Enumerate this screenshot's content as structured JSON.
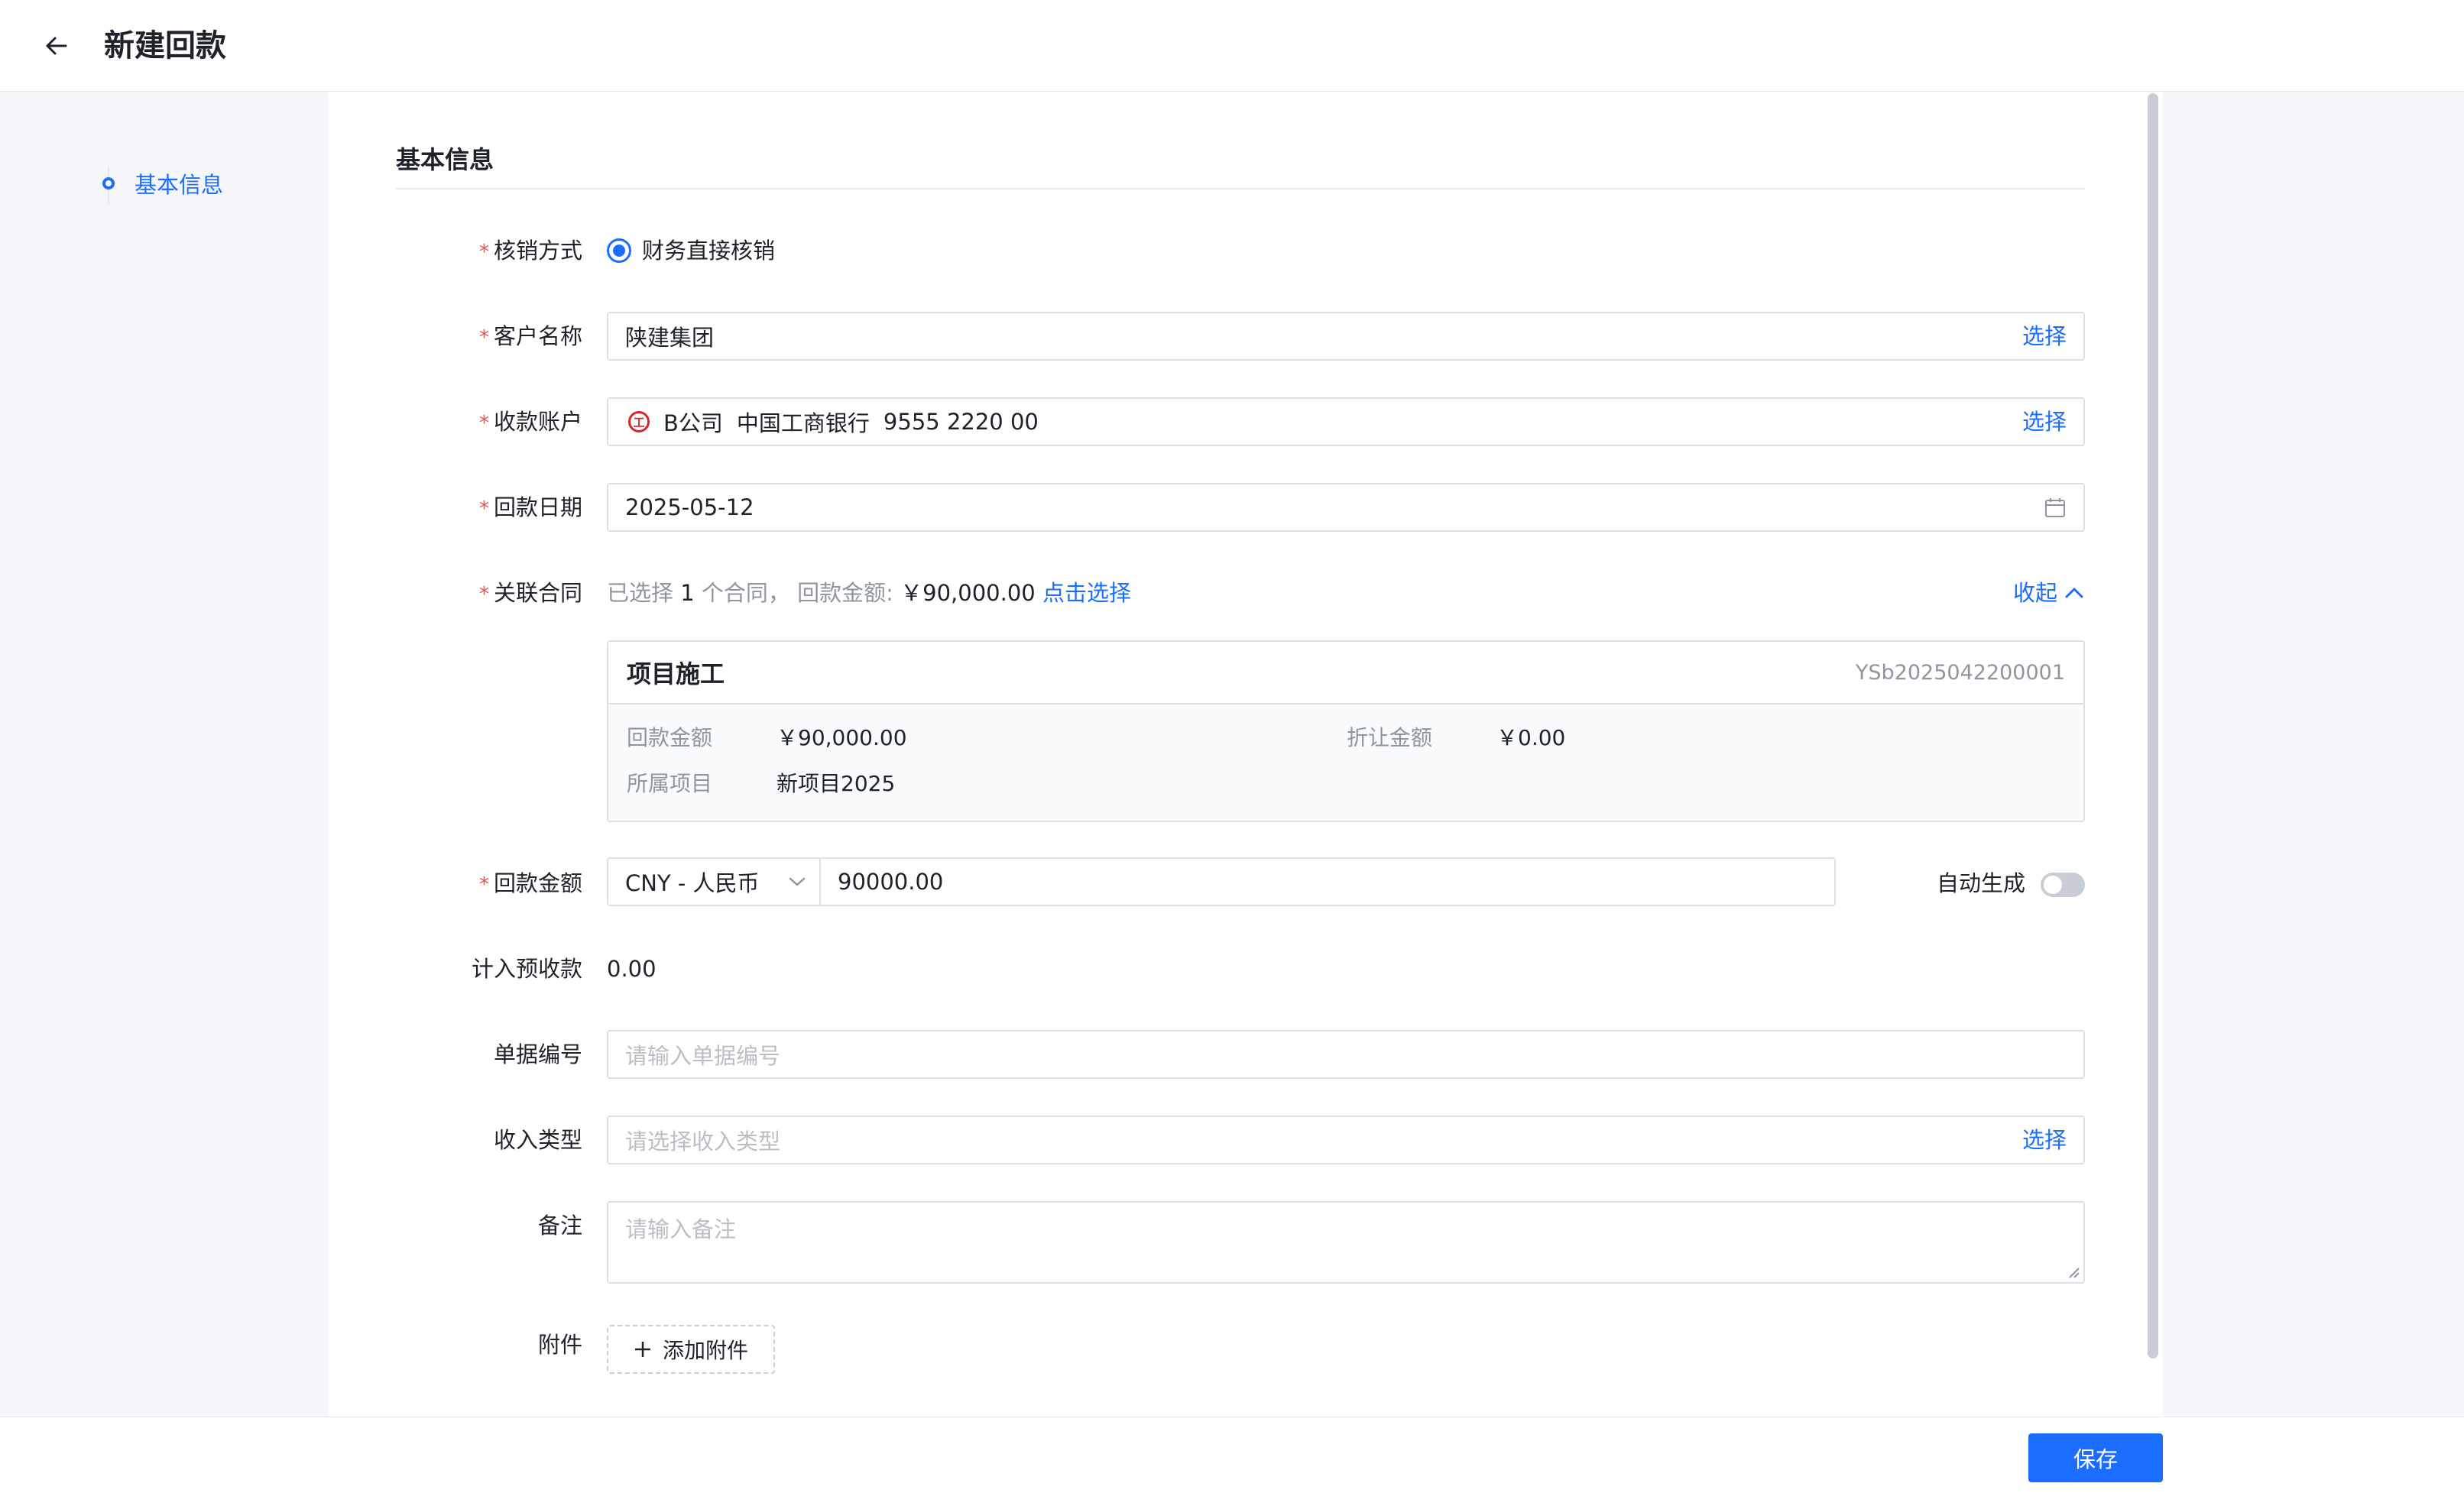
{
  "header": {
    "title": "新建回款"
  },
  "nav": {
    "items": [
      {
        "label": "基本信息"
      }
    ]
  },
  "section": {
    "title": "基本信息"
  },
  "form": {
    "writeoff": {
      "label": "核销方式",
      "option": "财务直接核销"
    },
    "customer": {
      "label": "客户名称",
      "value": "陕建集团",
      "action": "选择"
    },
    "account": {
      "label": "收款账户",
      "bank_icon_text": "工",
      "company": "B公司",
      "bank": "中国工商银行",
      "number": "9555 2220 00",
      "action": "选择"
    },
    "date": {
      "label": "回款日期",
      "value": "2025-05-12"
    },
    "contract": {
      "label": "关联合同",
      "summary_prefix": "已选择",
      "count": "1",
      "summary_mid": "个合同，",
      "amount_label": "回款金额:",
      "amount": "￥90,000.00",
      "select_link": "点击选择",
      "collapse": "收起",
      "card": {
        "name": "项目施工",
        "code": "YSb2025042200001",
        "payback_label": "回款金额",
        "payback_value": "￥90,000.00",
        "discount_label": "折让金额",
        "discount_value": "￥0.00",
        "project_label": "所属项目",
        "project_value": "新项目2025"
      }
    },
    "amount": {
      "label": "回款金额",
      "currency": "CNY - 人民币",
      "value": "90000.00",
      "auto_label": "自动生成",
      "auto_on": false
    },
    "prepaid": {
      "label": "计入预收款",
      "value": "0.00"
    },
    "doc_no": {
      "label": "单据编号",
      "placeholder": "请输入单据编号"
    },
    "income_type": {
      "label": "收入类型",
      "placeholder": "请选择收入类型",
      "action": "选择"
    },
    "remark": {
      "label": "备注",
      "placeholder": "请输入备注"
    },
    "attachment": {
      "label": "附件",
      "button": "添加附件"
    }
  },
  "footer": {
    "save_label": "保存"
  },
  "colors": {
    "primary": "#1a6dff",
    "required": "#f54a45",
    "bank": "#d8262d"
  }
}
